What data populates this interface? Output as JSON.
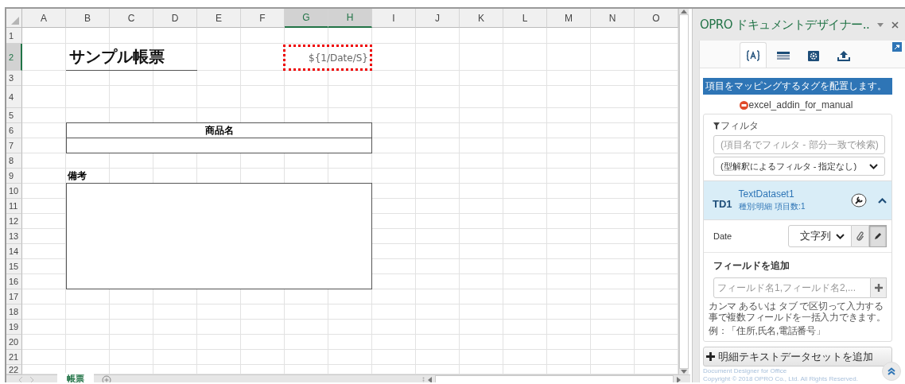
{
  "sheet": {
    "columns": [
      {
        "label": "A",
        "selected": false
      },
      {
        "label": "B",
        "selected": false
      },
      {
        "label": "C",
        "selected": false
      },
      {
        "label": "D",
        "selected": false
      },
      {
        "label": "E",
        "selected": false
      },
      {
        "label": "F",
        "selected": false
      },
      {
        "label": "G",
        "selected": true
      },
      {
        "label": "H",
        "selected": true
      },
      {
        "label": "I",
        "selected": false
      },
      {
        "label": "J",
        "selected": false
      },
      {
        "label": "K",
        "selected": false
      },
      {
        "label": "L",
        "selected": false
      },
      {
        "label": "M",
        "selected": false
      },
      {
        "label": "N",
        "selected": false
      },
      {
        "label": "O",
        "selected": false
      }
    ],
    "rows": [
      {
        "label": "1",
        "selected": false
      },
      {
        "label": "2",
        "selected": true
      },
      {
        "label": "3",
        "selected": false
      },
      {
        "label": "4",
        "selected": false
      },
      {
        "label": "5",
        "selected": false
      },
      {
        "label": "6",
        "selected": false
      },
      {
        "label": "7",
        "selected": false
      },
      {
        "label": "8",
        "selected": false
      },
      {
        "label": "9",
        "selected": false
      },
      {
        "label": "10",
        "selected": false
      },
      {
        "label": "11",
        "selected": false
      },
      {
        "label": "12",
        "selected": false
      },
      {
        "label": "13",
        "selected": false
      },
      {
        "label": "14",
        "selected": false
      },
      {
        "label": "15",
        "selected": false
      },
      {
        "label": "16",
        "selected": false
      },
      {
        "label": "17",
        "selected": false
      },
      {
        "label": "18",
        "selected": false
      },
      {
        "label": "19",
        "selected": false
      },
      {
        "label": "20",
        "selected": false
      },
      {
        "label": "21",
        "selected": false
      },
      {
        "label": "22",
        "selected": false
      }
    ],
    "cells": {
      "title": "サンプル帳票",
      "date_tag": "${1/Date/S}",
      "product_header": "商品名",
      "notes_label": "備考"
    },
    "sheet_tabs": [
      {
        "label": "帳票",
        "selected": true
      }
    ]
  },
  "panel": {
    "title": "OPRO ドキュメントデザイナー..",
    "tools": [
      {
        "kind": "tags",
        "selected": true
      },
      {
        "kind": "table",
        "selected": false
      },
      {
        "kind": "settings",
        "selected": false
      },
      {
        "kind": "upload",
        "selected": false
      }
    ],
    "banner": "項目をマッピングするタグを配置します。",
    "source": "excel_addin_for_manual",
    "filter": {
      "label": "フィルタ",
      "search_placeholder": "(項目名でフィルタ - 部分一致で検索)",
      "type_filter": "(型解釈によるフィルタ - 指定なし)"
    },
    "dataset": {
      "badge": "TD1",
      "name": "TextDataset1",
      "meta": "種別:明細  項目数:1",
      "expanded": true,
      "fields": [
        {
          "name": "Date",
          "type": "文字列"
        }
      ]
    },
    "add_field": {
      "label": "フィールドを追加",
      "placeholder": "フィールド名1,フィールド名2,...",
      "help": "カンマ あるいは タブ で区切って入力する事で複数フィールドを一括入力できます。",
      "example": "例：「住所,氏名,電話番号」"
    },
    "add_dataset_button": "明細テキストデータセットを追加",
    "footer": [
      "Document Designer for Office",
      "Copyright © 2018 OPRO Co., Ltd. All Rights Reserved."
    ]
  }
}
